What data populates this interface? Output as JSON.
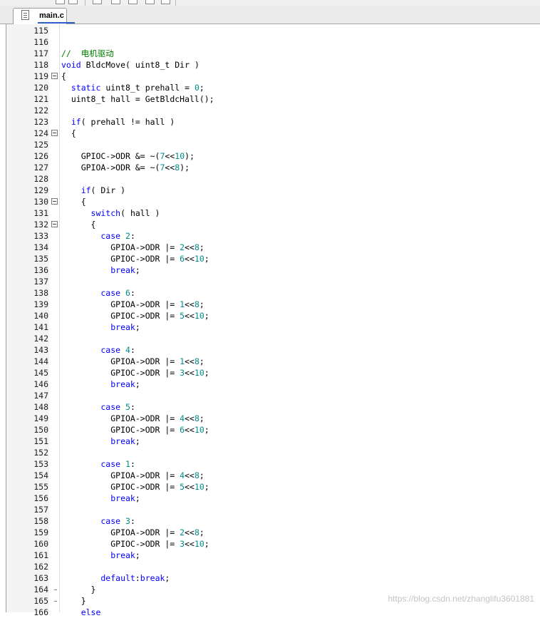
{
  "tab": {
    "label": "main.c",
    "icon": "c-source-file-icon"
  },
  "colors": {
    "keyword": "#0000ff",
    "number": "#008c8c",
    "comment": "#008000",
    "identifier": "#000000",
    "tab_accent": "#2a63c7"
  },
  "editor": {
    "lines": [
      {
        "n": "115",
        "fold": "",
        "tokens": []
      },
      {
        "n": "116",
        "fold": "",
        "tokens": []
      },
      {
        "n": "117",
        "fold": "",
        "tokens": [
          [
            "cm",
            "//  电机驱动"
          ]
        ]
      },
      {
        "n": "118",
        "fold": "",
        "tokens": [
          [
            "kw",
            "void"
          ],
          [
            "id",
            " BldcMove( uint8_t Dir )"
          ]
        ]
      },
      {
        "n": "119",
        "fold": "open",
        "tokens": [
          [
            "id",
            "{"
          ]
        ]
      },
      {
        "n": "120",
        "fold": "",
        "tokens": [
          [
            "kw",
            "  static"
          ],
          [
            "id",
            " uint8_t prehall = "
          ],
          [
            "num",
            "0"
          ],
          [
            "id",
            ";"
          ]
        ]
      },
      {
        "n": "121",
        "fold": "",
        "tokens": [
          [
            "id",
            "  uint8_t hall = GetBldcHall();"
          ]
        ]
      },
      {
        "n": "122",
        "fold": "",
        "tokens": []
      },
      {
        "n": "123",
        "fold": "",
        "tokens": [
          [
            "kw",
            "  if"
          ],
          [
            "id",
            "( prehall != hall )"
          ]
        ]
      },
      {
        "n": "124",
        "fold": "open",
        "tokens": [
          [
            "id",
            "  {"
          ]
        ]
      },
      {
        "n": "125",
        "fold": "",
        "tokens": []
      },
      {
        "n": "126",
        "fold": "",
        "tokens": [
          [
            "id",
            "    GPIOC->ODR &= ~("
          ],
          [
            "num",
            "7"
          ],
          [
            "id",
            "<<"
          ],
          [
            "num",
            "10"
          ],
          [
            "id",
            ");"
          ]
        ]
      },
      {
        "n": "127",
        "fold": "",
        "tokens": [
          [
            "id",
            "    GPIOA->ODR &= ~("
          ],
          [
            "num",
            "7"
          ],
          [
            "id",
            "<<"
          ],
          [
            "num",
            "8"
          ],
          [
            "id",
            ");"
          ]
        ]
      },
      {
        "n": "128",
        "fold": "",
        "tokens": []
      },
      {
        "n": "129",
        "fold": "",
        "tokens": [
          [
            "kw",
            "    if"
          ],
          [
            "id",
            "( Dir )"
          ]
        ]
      },
      {
        "n": "130",
        "fold": "open",
        "tokens": [
          [
            "id",
            "    {"
          ]
        ]
      },
      {
        "n": "131",
        "fold": "",
        "tokens": [
          [
            "kw",
            "      switch"
          ],
          [
            "id",
            "( hall )"
          ]
        ]
      },
      {
        "n": "132",
        "fold": "open",
        "tokens": [
          [
            "id",
            "      {"
          ]
        ]
      },
      {
        "n": "133",
        "fold": "",
        "tokens": [
          [
            "kw",
            "        case"
          ],
          [
            "id",
            " "
          ],
          [
            "num",
            "2"
          ],
          [
            "id",
            ":"
          ]
        ]
      },
      {
        "n": "134",
        "fold": "",
        "tokens": [
          [
            "id",
            "          GPIOA->ODR |= "
          ],
          [
            "num",
            "2"
          ],
          [
            "id",
            "<<"
          ],
          [
            "num",
            "8"
          ],
          [
            "id",
            ";"
          ]
        ]
      },
      {
        "n": "135",
        "fold": "",
        "tokens": [
          [
            "id",
            "          GPIOC->ODR |= "
          ],
          [
            "num",
            "6"
          ],
          [
            "id",
            "<<"
          ],
          [
            "num",
            "10"
          ],
          [
            "id",
            ";"
          ]
        ]
      },
      {
        "n": "136",
        "fold": "",
        "tokens": [
          [
            "kw",
            "          break"
          ],
          [
            "id",
            ";"
          ]
        ]
      },
      {
        "n": "137",
        "fold": "",
        "tokens": []
      },
      {
        "n": "138",
        "fold": "",
        "tokens": [
          [
            "kw",
            "        case"
          ],
          [
            "id",
            " "
          ],
          [
            "num",
            "6"
          ],
          [
            "id",
            ":"
          ]
        ]
      },
      {
        "n": "139",
        "fold": "",
        "tokens": [
          [
            "id",
            "          GPIOA->ODR |= "
          ],
          [
            "num",
            "1"
          ],
          [
            "id",
            "<<"
          ],
          [
            "num",
            "8"
          ],
          [
            "id",
            ";"
          ]
        ]
      },
      {
        "n": "140",
        "fold": "",
        "tokens": [
          [
            "id",
            "          GPIOC->ODR |= "
          ],
          [
            "num",
            "5"
          ],
          [
            "id",
            "<<"
          ],
          [
            "num",
            "10"
          ],
          [
            "id",
            ";"
          ]
        ]
      },
      {
        "n": "141",
        "fold": "",
        "tokens": [
          [
            "kw",
            "          break"
          ],
          [
            "id",
            ";"
          ]
        ]
      },
      {
        "n": "142",
        "fold": "",
        "tokens": []
      },
      {
        "n": "143",
        "fold": "",
        "tokens": [
          [
            "kw",
            "        case"
          ],
          [
            "id",
            " "
          ],
          [
            "num",
            "4"
          ],
          [
            "id",
            ":"
          ]
        ]
      },
      {
        "n": "144",
        "fold": "",
        "tokens": [
          [
            "id",
            "          GPIOA->ODR |= "
          ],
          [
            "num",
            "1"
          ],
          [
            "id",
            "<<"
          ],
          [
            "num",
            "8"
          ],
          [
            "id",
            ";"
          ]
        ]
      },
      {
        "n": "145",
        "fold": "",
        "tokens": [
          [
            "id",
            "          GPIOC->ODR |= "
          ],
          [
            "num",
            "3"
          ],
          [
            "id",
            "<<"
          ],
          [
            "num",
            "10"
          ],
          [
            "id",
            ";"
          ]
        ]
      },
      {
        "n": "146",
        "fold": "",
        "tokens": [
          [
            "kw",
            "          break"
          ],
          [
            "id",
            ";"
          ]
        ]
      },
      {
        "n": "147",
        "fold": "",
        "tokens": []
      },
      {
        "n": "148",
        "fold": "",
        "tokens": [
          [
            "kw",
            "        case"
          ],
          [
            "id",
            " "
          ],
          [
            "num",
            "5"
          ],
          [
            "id",
            ":"
          ]
        ]
      },
      {
        "n": "149",
        "fold": "",
        "tokens": [
          [
            "id",
            "          GPIOA->ODR |= "
          ],
          [
            "num",
            "4"
          ],
          [
            "id",
            "<<"
          ],
          [
            "num",
            "8"
          ],
          [
            "id",
            ";"
          ]
        ]
      },
      {
        "n": "150",
        "fold": "",
        "tokens": [
          [
            "id",
            "          GPIOC->ODR |= "
          ],
          [
            "num",
            "6"
          ],
          [
            "id",
            "<<"
          ],
          [
            "num",
            "10"
          ],
          [
            "id",
            ";"
          ]
        ]
      },
      {
        "n": "151",
        "fold": "",
        "tokens": [
          [
            "kw",
            "          break"
          ],
          [
            "id",
            ";"
          ]
        ]
      },
      {
        "n": "152",
        "fold": "",
        "tokens": []
      },
      {
        "n": "153",
        "fold": "",
        "tokens": [
          [
            "kw",
            "        case"
          ],
          [
            "id",
            " "
          ],
          [
            "num",
            "1"
          ],
          [
            "id",
            ":"
          ]
        ]
      },
      {
        "n": "154",
        "fold": "",
        "tokens": [
          [
            "id",
            "          GPIOA->ODR |= "
          ],
          [
            "num",
            "4"
          ],
          [
            "id",
            "<<"
          ],
          [
            "num",
            "8"
          ],
          [
            "id",
            ";"
          ]
        ]
      },
      {
        "n": "155",
        "fold": "",
        "tokens": [
          [
            "id",
            "          GPIOC->ODR |= "
          ],
          [
            "num",
            "5"
          ],
          [
            "id",
            "<<"
          ],
          [
            "num",
            "10"
          ],
          [
            "id",
            ";"
          ]
        ]
      },
      {
        "n": "156",
        "fold": "",
        "tokens": [
          [
            "kw",
            "          break"
          ],
          [
            "id",
            ";"
          ]
        ]
      },
      {
        "n": "157",
        "fold": "",
        "tokens": []
      },
      {
        "n": "158",
        "fold": "",
        "tokens": [
          [
            "kw",
            "        case"
          ],
          [
            "id",
            " "
          ],
          [
            "num",
            "3"
          ],
          [
            "id",
            ":"
          ]
        ]
      },
      {
        "n": "159",
        "fold": "",
        "tokens": [
          [
            "id",
            "          GPIOA->ODR |= "
          ],
          [
            "num",
            "2"
          ],
          [
            "id",
            "<<"
          ],
          [
            "num",
            "8"
          ],
          [
            "id",
            ";"
          ]
        ]
      },
      {
        "n": "160",
        "fold": "",
        "tokens": [
          [
            "id",
            "          GPIOC->ODR |= "
          ],
          [
            "num",
            "3"
          ],
          [
            "id",
            "<<"
          ],
          [
            "num",
            "10"
          ],
          [
            "id",
            ";"
          ]
        ]
      },
      {
        "n": "161",
        "fold": "",
        "tokens": [
          [
            "kw",
            "          break"
          ],
          [
            "id",
            ";"
          ]
        ]
      },
      {
        "n": "162",
        "fold": "",
        "tokens": []
      },
      {
        "n": "163",
        "fold": "",
        "tokens": [
          [
            "kw",
            "        default"
          ],
          [
            "id",
            ":"
          ],
          [
            "kw",
            "break"
          ],
          [
            "id",
            ";"
          ]
        ]
      },
      {
        "n": "164",
        "fold": "end",
        "tokens": [
          [
            "id",
            "      }"
          ]
        ]
      },
      {
        "n": "165",
        "fold": "end",
        "tokens": [
          [
            "id",
            "    }"
          ]
        ]
      },
      {
        "n": "166",
        "fold": "",
        "tokens": [
          [
            "kw",
            "    else"
          ]
        ]
      }
    ]
  },
  "watermark": "https://blog.csdn.net/zhanglifu3601881"
}
